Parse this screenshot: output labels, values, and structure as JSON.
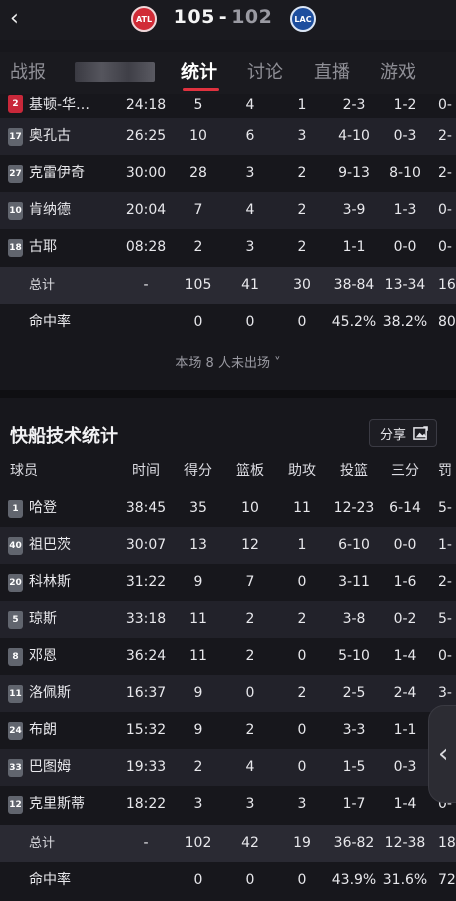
{
  "header": {
    "home_team_logo_text": "ATL",
    "away_team_logo_text": "LAC",
    "home_score": "105",
    "separator": "-",
    "away_score": "102"
  },
  "tabs": [
    {
      "label": "战报"
    },
    {
      "label": "统计"
    },
    {
      "label": "讨论"
    },
    {
      "label": "直播"
    },
    {
      "label": "游戏"
    }
  ],
  "home_players": [
    {
      "number": "2",
      "name": "基顿-华…",
      "time": "24:18",
      "pts": "5",
      "reb": "4",
      "ast": "1",
      "fg": "2-3",
      "tp": "1-2",
      "ft": "0-",
      "jersey_color": "#c8283a"
    },
    {
      "number": "17",
      "name": "奥孔古",
      "time": "26:25",
      "pts": "10",
      "reb": "6",
      "ast": "3",
      "fg": "4-10",
      "tp": "0-3",
      "ft": "2-"
    },
    {
      "number": "27",
      "name": "克雷伊奇",
      "time": "30:00",
      "pts": "28",
      "reb": "3",
      "ast": "2",
      "fg": "9-13",
      "tp": "8-10",
      "ft": "2-"
    },
    {
      "number": "10",
      "name": "肯纳德",
      "time": "20:04",
      "pts": "7",
      "reb": "4",
      "ast": "2",
      "fg": "3-9",
      "tp": "1-3",
      "ft": "0-"
    },
    {
      "number": "18",
      "name": "古耶",
      "time": "08:28",
      "pts": "2",
      "reb": "3",
      "ast": "2",
      "fg": "1-1",
      "tp": "0-0",
      "ft": "0-"
    }
  ],
  "home_total": {
    "label": "总计",
    "time": "-",
    "pts": "105",
    "reb": "41",
    "ast": "30",
    "fg": "38-84",
    "tp": "13-34",
    "ft": "16-"
  },
  "home_pct": {
    "label": "命中率",
    "pts": "0",
    "reb": "0",
    "ast": "0",
    "fg": "45.2%",
    "tp": "38.2%",
    "ft": "80"
  },
  "dnp_text": "本场 8 人未出场 ˅",
  "away_section": {
    "title": "快船技术统计",
    "share_label": "分享"
  },
  "columns": {
    "name": "球员",
    "time": "时间",
    "pts": "得分",
    "reb": "篮板",
    "ast": "助攻",
    "fg": "投篮",
    "tp": "三分",
    "ft": "罚"
  },
  "away_players": [
    {
      "number": "1",
      "name": "哈登",
      "time": "38:45",
      "pts": "35",
      "reb": "10",
      "ast": "11",
      "fg": "12-23",
      "tp": "6-14",
      "ft": "5-"
    },
    {
      "number": "40",
      "name": "祖巴茨",
      "time": "30:07",
      "pts": "13",
      "reb": "12",
      "ast": "1",
      "fg": "6-10",
      "tp": "0-0",
      "ft": "1-"
    },
    {
      "number": "20",
      "name": "科林斯",
      "time": "31:22",
      "pts": "9",
      "reb": "7",
      "ast": "0",
      "fg": "3-11",
      "tp": "1-6",
      "ft": "2-"
    },
    {
      "number": "5",
      "name": "琼斯",
      "time": "33:18",
      "pts": "11",
      "reb": "2",
      "ast": "2",
      "fg": "3-8",
      "tp": "0-2",
      "ft": "5-"
    },
    {
      "number": "8",
      "name": "邓恩",
      "time": "36:24",
      "pts": "11",
      "reb": "2",
      "ast": "0",
      "fg": "5-10",
      "tp": "1-4",
      "ft": "0-"
    },
    {
      "number": "11",
      "name": "洛佩斯",
      "time": "16:37",
      "pts": "9",
      "reb": "0",
      "ast": "2",
      "fg": "2-5",
      "tp": "2-4",
      "ft": "3-"
    },
    {
      "number": "24",
      "name": "布朗",
      "time": "15:32",
      "pts": "9",
      "reb": "2",
      "ast": "0",
      "fg": "3-3",
      "tp": "1-1",
      "ft": "2-"
    },
    {
      "number": "33",
      "name": "巴图姆",
      "time": "19:33",
      "pts": "2",
      "reb": "4",
      "ast": "0",
      "fg": "1-5",
      "tp": "0-3",
      "ft": "0-"
    },
    {
      "number": "12",
      "name": "克里斯蒂",
      "time": "18:22",
      "pts": "3",
      "reb": "3",
      "ast": "3",
      "fg": "1-7",
      "tp": "1-4",
      "ft": "0-"
    }
  ],
  "away_total": {
    "label": "总计",
    "time": "-",
    "pts": "102",
    "reb": "42",
    "ast": "19",
    "fg": "36-82",
    "tp": "12-38",
    "ft": "18-"
  },
  "away_pct": {
    "label": "命中率",
    "pts": "0",
    "reb": "0",
    "ast": "0",
    "fg": "43.9%",
    "tp": "31.6%",
    "ft": "72"
  },
  "colors": {
    "accent": "#e0323f",
    "background": "#17171c",
    "row_alt": "#22222a",
    "jersey_default": "#61656e"
  },
  "icons": {
    "back": "chevron-left-icon",
    "share": "image-share-icon",
    "side_tab": "chevron-left-icon"
  }
}
